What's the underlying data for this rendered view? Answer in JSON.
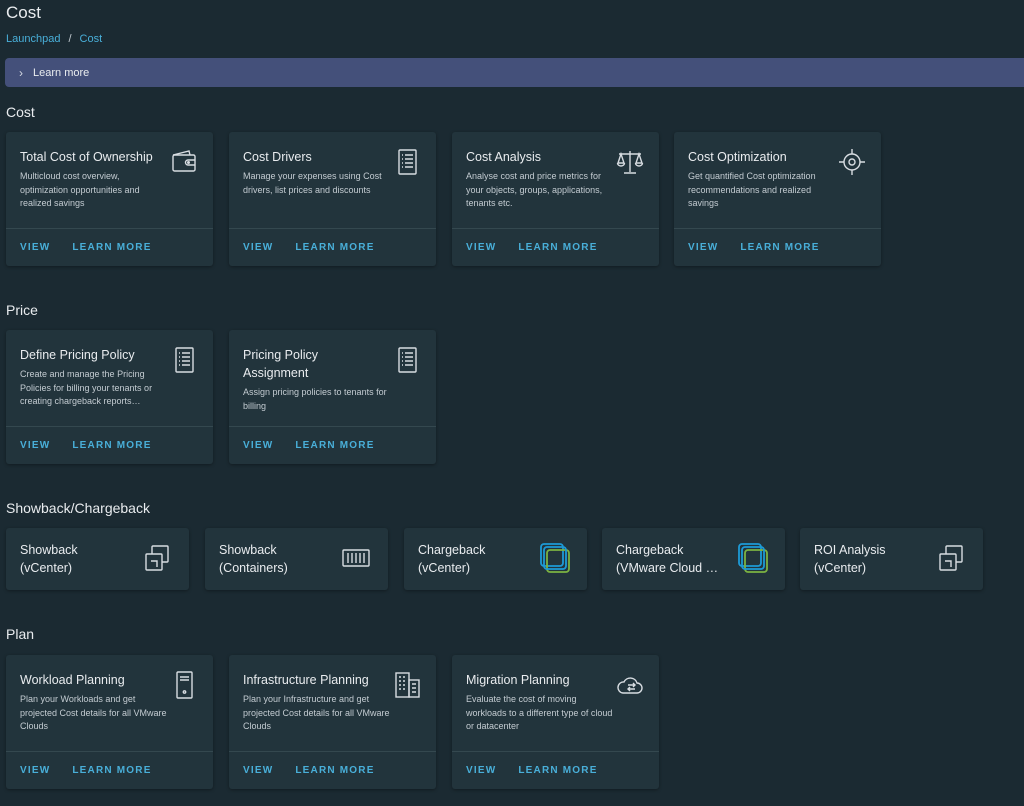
{
  "page": {
    "title": "Cost"
  },
  "breadcrumb": {
    "items": [
      "Launchpad",
      "Cost"
    ],
    "separator": "/"
  },
  "learn_bar": {
    "label": "Learn more"
  },
  "actions": {
    "view": "VIEW",
    "learn_more": "LEARN MORE"
  },
  "sections": {
    "cost": {
      "title": "Cost",
      "cards": [
        {
          "title": "Total Cost of Ownership",
          "description": "Multicloud cost overview, optimization opportunities and realized savings",
          "icon": "wallet-icon"
        },
        {
          "title": "Cost Drivers",
          "description": "Manage your expenses using Cost drivers, list prices and discounts",
          "icon": "list-document-icon"
        },
        {
          "title": "Cost Analysis",
          "description": "Analyse cost and price metrics for your objects, groups, applications, tenants etc.",
          "icon": "balance-scale-icon"
        },
        {
          "title": "Cost Optimization",
          "description": "Get quantified Cost optimization recommendations and realized savings",
          "icon": "target-icon"
        }
      ]
    },
    "price": {
      "title": "Price",
      "cards": [
        {
          "title": "Define Pricing Policy",
          "description": "Create and manage the Pricing Policies for billing your tenants or creating chargeback reports…",
          "icon": "list-document-icon"
        },
        {
          "title": "Pricing Policy Assignment",
          "description": "Assign pricing policies to tenants for billing",
          "icon": "list-document-icon"
        }
      ]
    },
    "showback": {
      "title": "Showback/Chargeback",
      "tiles": [
        {
          "title": "Showback",
          "subtitle": "(vCenter)",
          "icon": "copy-window-icon"
        },
        {
          "title": "Showback",
          "subtitle": "(Containers)",
          "icon": "containers-icon"
        },
        {
          "title": "Chargeback",
          "subtitle": "(vCenter)",
          "icon": "vmware-logo-icon"
        },
        {
          "title": "Chargeback",
          "subtitle": "(VMware Cloud Director)",
          "icon": "vmware-logo-icon"
        },
        {
          "title": "ROI Analysis",
          "subtitle": "(vCenter)",
          "icon": "copy-window-icon"
        }
      ]
    },
    "plan": {
      "title": "Plan",
      "cards": [
        {
          "title": "Workload Planning",
          "description": "Plan your Workloads and get projected Cost details for all VMware Clouds",
          "icon": "server-icon"
        },
        {
          "title": "Infrastructure Planning",
          "description": "Plan your Infrastructure and get projected Cost details for all VMware Clouds",
          "icon": "building-icon"
        },
        {
          "title": "Migration Planning",
          "description": "Evaluate the cost of moving workloads to a different type of cloud or datacenter",
          "icon": "cloud-migrate-icon"
        }
      ]
    }
  }
}
